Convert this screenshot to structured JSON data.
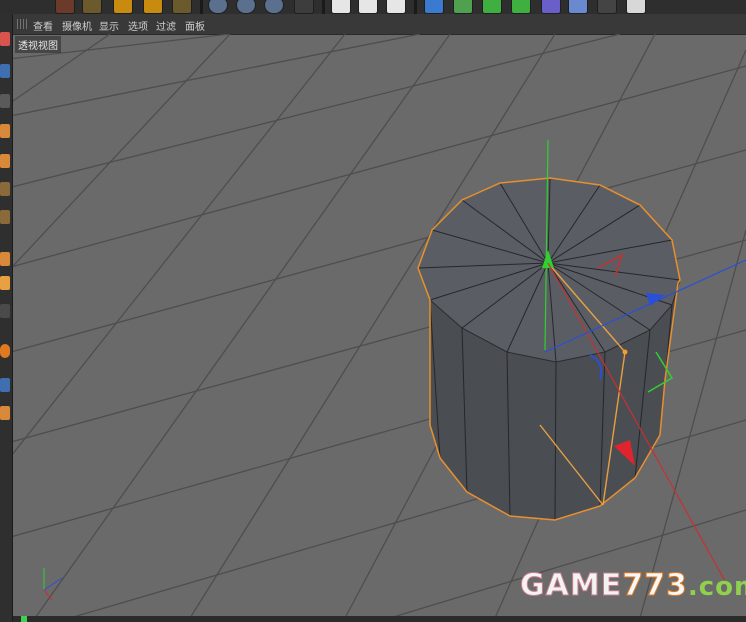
{
  "menu": {
    "items": [
      "查看",
      "摄像机",
      "显示",
      "选项",
      "过滤",
      "面板"
    ]
  },
  "viewport": {
    "name": "透视视图"
  },
  "toolbar": {
    "icons": [
      "undo-icon",
      "move-icon",
      "scale-icon",
      "rotate-icon",
      "pointer-icon",
      "x-axis-icon",
      "y-axis-icon",
      "z-axis-icon",
      "coordinate-system-icon",
      "render-view-icon",
      "render-picture-viewer-icon",
      "render-settings-icon",
      "cube-primitive-icon",
      "nurbs-icon",
      "generator-icon",
      "deformer-icon",
      "scene-icon",
      "floor-icon",
      "camera-icon",
      "light-icon"
    ]
  },
  "watermark": {
    "part1": "GAME",
    "part2": "773",
    "part3": ".com"
  },
  "colors": {
    "grid_background": "#6a6a6a",
    "selection_outline": "#e8902e",
    "axis_x": "#e0242e",
    "axis_y": "#2fd02f",
    "axis_z": "#2a4fd8"
  }
}
